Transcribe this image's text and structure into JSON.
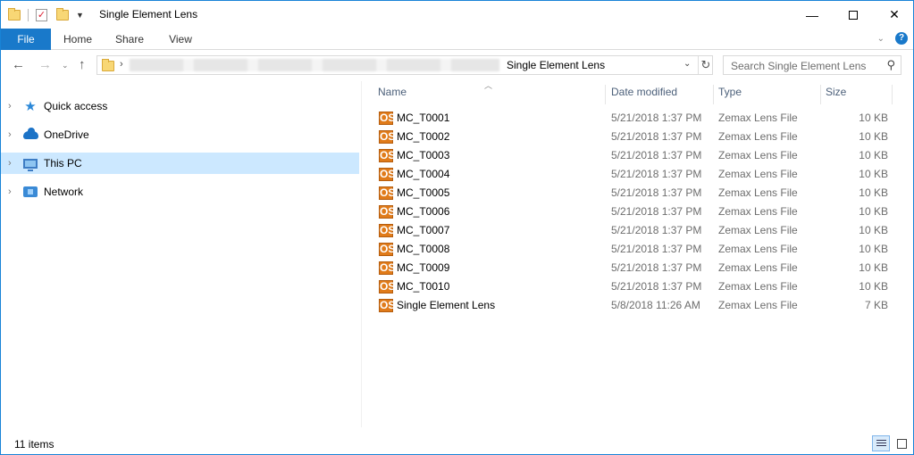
{
  "window": {
    "title": "Single Element Lens",
    "minimize_glyph": "—",
    "close_glyph": "✕"
  },
  "ribbon": {
    "tabs": [
      "File",
      "Home",
      "Share",
      "View"
    ]
  },
  "address": {
    "current_folder": "Single Element Lens",
    "separator": "›"
  },
  "search": {
    "placeholder": "Search Single Element Lens"
  },
  "nav": {
    "items": [
      {
        "label": "Quick access",
        "icon": "star-icon"
      },
      {
        "label": "OneDrive",
        "icon": "cloud-icon"
      },
      {
        "label": "This PC",
        "icon": "computer-icon",
        "selected": true
      },
      {
        "label": "Network",
        "icon": "network-icon"
      }
    ]
  },
  "columns": {
    "name": "Name",
    "date": "Date modified",
    "type": "Type",
    "size": "Size"
  },
  "file_icon_text": "OS",
  "files": [
    {
      "name": "MC_T0001",
      "date": "5/21/2018 1:37 PM",
      "type": "Zemax Lens File",
      "size": "10 KB"
    },
    {
      "name": "MC_T0002",
      "date": "5/21/2018 1:37 PM",
      "type": "Zemax Lens File",
      "size": "10 KB"
    },
    {
      "name": "MC_T0003",
      "date": "5/21/2018 1:37 PM",
      "type": "Zemax Lens File",
      "size": "10 KB"
    },
    {
      "name": "MC_T0004",
      "date": "5/21/2018 1:37 PM",
      "type": "Zemax Lens File",
      "size": "10 KB"
    },
    {
      "name": "MC_T0005",
      "date": "5/21/2018 1:37 PM",
      "type": "Zemax Lens File",
      "size": "10 KB"
    },
    {
      "name": "MC_T0006",
      "date": "5/21/2018 1:37 PM",
      "type": "Zemax Lens File",
      "size": "10 KB"
    },
    {
      "name": "MC_T0007",
      "date": "5/21/2018 1:37 PM",
      "type": "Zemax Lens File",
      "size": "10 KB"
    },
    {
      "name": "MC_T0008",
      "date": "5/21/2018 1:37 PM",
      "type": "Zemax Lens File",
      "size": "10 KB"
    },
    {
      "name": "MC_T0009",
      "date": "5/21/2018 1:37 PM",
      "type": "Zemax Lens File",
      "size": "10 KB"
    },
    {
      "name": "MC_T0010",
      "date": "5/21/2018 1:37 PM",
      "type": "Zemax Lens File",
      "size": "10 KB"
    },
    {
      "name": "Single Element Lens",
      "date": "5/8/2018 11:26 AM",
      "type": "Zemax Lens File",
      "size": "7 KB"
    }
  ],
  "status": {
    "item_count": "11 items"
  },
  "colors": {
    "accent": "#1979ca",
    "selection": "#cce8ff",
    "file_icon": "#e07b1a"
  }
}
